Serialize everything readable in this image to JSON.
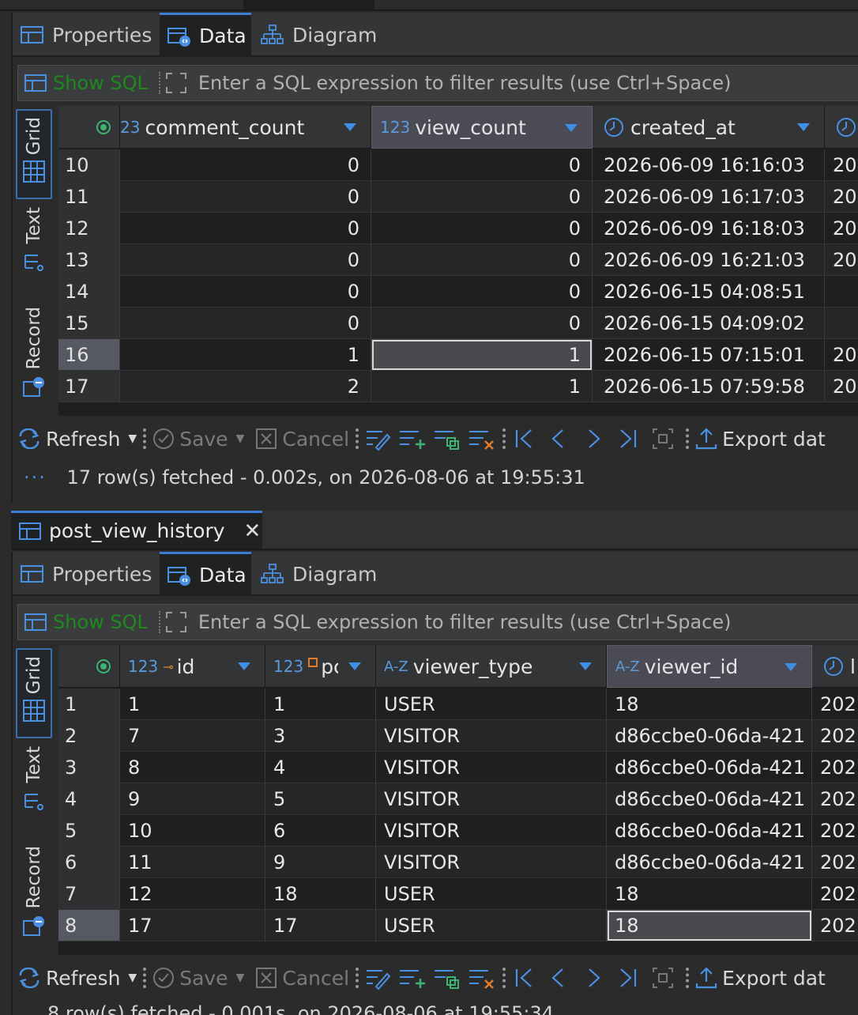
{
  "subtabs": {
    "properties": "Properties",
    "data": "Data",
    "diagram": "Diagram"
  },
  "filter": {
    "show_sql": "Show SQL",
    "placeholder": "Enter a SQL expression to filter results (use Ctrl+Space)"
  },
  "vtabs": {
    "grid": "Grid",
    "text": "Text",
    "record": "Record"
  },
  "toolbar": {
    "refresh": "Refresh",
    "save": "Save",
    "cancel": "Cancel",
    "export": "Export dat"
  },
  "grid1": {
    "columns": [
      {
        "type": "23",
        "name": "comment_count"
      },
      {
        "type": "123",
        "name": "view_count"
      },
      {
        "type": "",
        "name": "created_at"
      }
    ],
    "rows": [
      {
        "n": "10",
        "c": "0",
        "v": "0",
        "t": "2026-06-09 16:16:03",
        "x": "20"
      },
      {
        "n": "11",
        "c": "0",
        "v": "0",
        "t": "2026-06-09 16:17:03",
        "x": "20"
      },
      {
        "n": "12",
        "c": "0",
        "v": "0",
        "t": "2026-06-09 16:18:03",
        "x": "20"
      },
      {
        "n": "13",
        "c": "0",
        "v": "0",
        "t": "2026-06-09 16:21:03",
        "x": "20"
      },
      {
        "n": "14",
        "c": "0",
        "v": "0",
        "t": "2026-06-15 04:08:51",
        "x": ""
      },
      {
        "n": "15",
        "c": "0",
        "v": "0",
        "t": "2026-06-15 04:09:02",
        "x": ""
      },
      {
        "n": "16",
        "c": "1",
        "v": "1",
        "t": "2026-06-15 07:15:01",
        "x": "20"
      },
      {
        "n": "17",
        "c": "2",
        "v": "1",
        "t": "2026-06-15 07:59:58",
        "x": "20"
      }
    ],
    "status": "17 row(s) fetched - 0.002s, on 2026-08-06 at 19:55:31"
  },
  "editor_tab": {
    "title": "post_view_history"
  },
  "grid2": {
    "columns": [
      {
        "type": "123",
        "name": "id"
      },
      {
        "type": "123",
        "name": "pc"
      },
      {
        "type": "A-Z",
        "name": "viewer_type"
      },
      {
        "type": "A-Z",
        "name": "viewer_id"
      },
      {
        "type": "",
        "name": "l"
      }
    ],
    "rows": [
      {
        "n": "1",
        "id": "1",
        "p": "1",
        "vt": "USER",
        "vi": "18",
        "x": "202"
      },
      {
        "n": "2",
        "id": "7",
        "p": "3",
        "vt": "VISITOR",
        "vi": "d86ccbe0-06da-421",
        "x": "202"
      },
      {
        "n": "3",
        "id": "8",
        "p": "4",
        "vt": "VISITOR",
        "vi": "d86ccbe0-06da-421",
        "x": "202"
      },
      {
        "n": "4",
        "id": "9",
        "p": "5",
        "vt": "VISITOR",
        "vi": "d86ccbe0-06da-421",
        "x": "202"
      },
      {
        "n": "5",
        "id": "10",
        "p": "6",
        "vt": "VISITOR",
        "vi": "d86ccbe0-06da-421",
        "x": "202"
      },
      {
        "n": "6",
        "id": "11",
        "p": "9",
        "vt": "VISITOR",
        "vi": "d86ccbe0-06da-421",
        "x": "202"
      },
      {
        "n": "7",
        "id": "12",
        "p": "18",
        "vt": "USER",
        "vi": "18",
        "x": "202"
      },
      {
        "n": "8",
        "id": "17",
        "p": "17",
        "vt": "USER",
        "vi": "18",
        "x": "202"
      }
    ],
    "status": "8 row(s) fetched - 0.001s, on 2026-08-06 at 19:55:34"
  }
}
